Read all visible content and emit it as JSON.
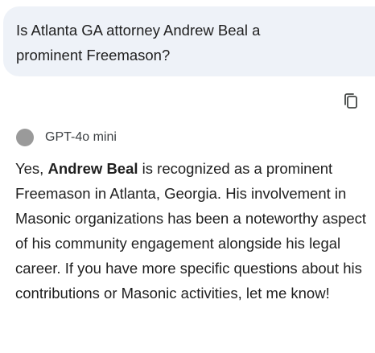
{
  "user_message": {
    "text": "Is Atlanta GA attorney Andrew Beal a prominent Freemason?"
  },
  "actions": {
    "copy_icon": "copy-icon"
  },
  "assistant": {
    "model_name": "GPT-4o mini",
    "avatar_color": "#9a9a9a",
    "response": {
      "prefix": "Yes, ",
      "bold": "Andrew Beal",
      "suffix": " is recognized as a prominent Freemason in Atlanta, Georgia. His involvement in Masonic organizations has been a noteworthy aspect of his community engagement alongside his legal career. If you have more specific questions about his contributions or Masonic activities, let me know!"
    }
  },
  "colors": {
    "user_bubble_bg": "#eef2f8",
    "text": "#1f1f1f"
  }
}
